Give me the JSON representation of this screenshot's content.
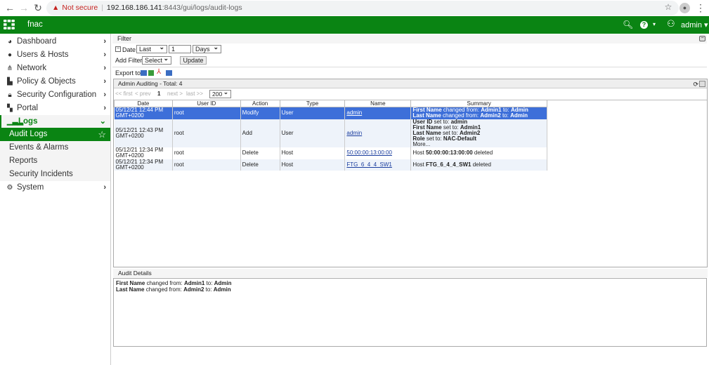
{
  "browser": {
    "not_secure": "Not secure",
    "url_host": "192.168.186.141",
    "url_path": ":8443/gui/logs/audit-logs"
  },
  "header": {
    "brand": "fnac",
    "user": "admin",
    "colors": {
      "accent": "#0a8413",
      "selected_row": "#3d6fd9"
    }
  },
  "sidebar": {
    "items": [
      {
        "label": "Dashboard",
        "icon": "dashboard-icon"
      },
      {
        "label": "Users & Hosts",
        "icon": "user-icon"
      },
      {
        "label": "Network",
        "icon": "network-icon"
      },
      {
        "label": "Policy & Objects",
        "icon": "policy-icon"
      },
      {
        "label": "Security Configuration",
        "icon": "lock-icon"
      },
      {
        "label": "Portal",
        "icon": "portal-icon"
      },
      {
        "label": "Logs",
        "icon": "chart-icon"
      },
      {
        "label": "Audit Logs"
      },
      {
        "label": "Events & Alarms"
      },
      {
        "label": "Reports"
      },
      {
        "label": "Security Incidents"
      },
      {
        "label": "System",
        "icon": "gear-icon"
      }
    ]
  },
  "filter": {
    "title": "Filter",
    "date_label": "Date:",
    "date_mode": "Last",
    "date_value": "1",
    "date_unit": "Days",
    "add_filter_label": "Add Filter:",
    "add_filter_value": "Select",
    "update": "Update",
    "export_label": "Export to:"
  },
  "panel": {
    "title": "Admin Auditing - Total: 4",
    "pager": {
      "first": "<< first",
      "prev": "< prev",
      "page": "1",
      "next": "next >",
      "last": "last >>",
      "page_size": "200"
    },
    "columns": [
      "Date",
      "User ID",
      "Action",
      "Type",
      "Name",
      "Summary"
    ],
    "rows": [
      {
        "date": "05/12/21 12:44 PM",
        "tz": "GMT+0200",
        "user": "root",
        "action": "Modify",
        "type": "User",
        "name": "admin",
        "summary": [
          [
            "First Name",
            " changed from: ",
            "Admin1",
            " to: ",
            "Admin"
          ],
          [
            "Last Name",
            " changed from: ",
            "Admin2",
            " to: ",
            "Admin"
          ]
        ]
      },
      {
        "date": "05/12/21 12:43 PM",
        "tz": "GMT+0200",
        "user": "root",
        "action": "Add",
        "type": "User",
        "name": "admin",
        "summary": [
          [
            "User ID",
            " set to: ",
            "admin"
          ],
          [
            "First Name",
            " set to: ",
            "Admin1"
          ],
          [
            "Last Name",
            " set to: ",
            "Admin2"
          ],
          [
            "Role",
            " set to: ",
            "NAC-Default"
          ]
        ],
        "more": "More..."
      },
      {
        "date": "05/12/21 12:34 PM",
        "tz": "GMT+0200",
        "user": "root",
        "action": "Delete",
        "type": "Host",
        "name": "50:00:00:13:00:00",
        "summary": [
          [
            "",
            "Host ",
            "50:00:00:13:00:00",
            " deleted"
          ]
        ]
      },
      {
        "date": "05/12/21 12:34 PM",
        "tz": "GMT+0200",
        "user": "root",
        "action": "Delete",
        "type": "Host",
        "name": "FTG_6_4_4_SW1",
        "summary": [
          [
            "",
            "Host ",
            "FTG_6_4_4_SW1",
            " deleted"
          ]
        ]
      }
    ]
  },
  "details": {
    "title": "Audit Details",
    "lines": [
      [
        "First Name",
        " changed from: ",
        "Admin1",
        " to: ",
        "Admin"
      ],
      [
        "Last Name",
        " changed from: ",
        "Admin2",
        " to: ",
        "Admin"
      ]
    ]
  }
}
